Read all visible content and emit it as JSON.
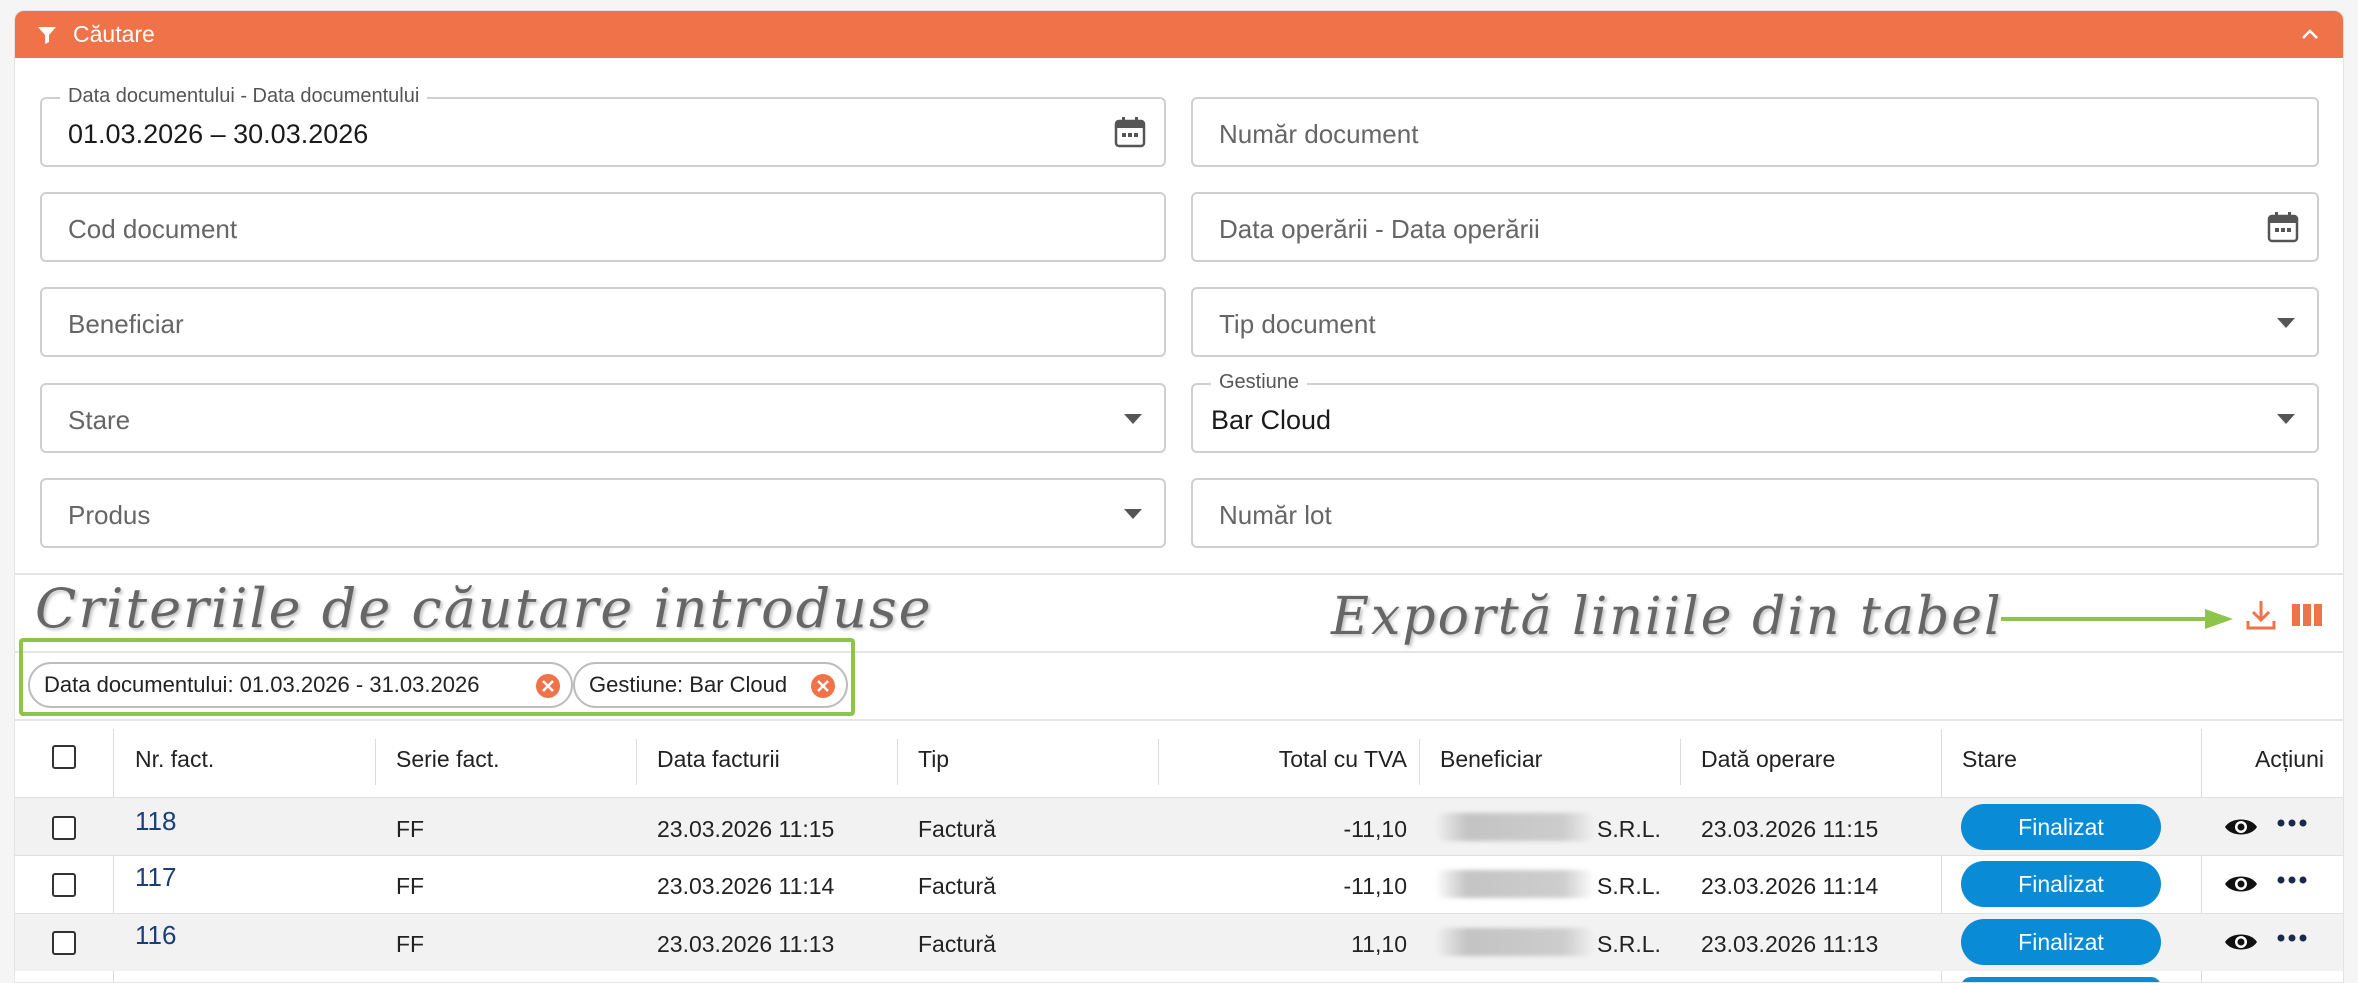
{
  "header": {
    "title": "Căutare",
    "filter_icon": "filter-icon",
    "collapse_icon": "chevron-up-icon",
    "color": "#f07248"
  },
  "filters": {
    "data_documentului": {
      "label": "Data documentului - Data documentului",
      "value": "01.03.2026 – 30.03.2026"
    },
    "numar_document": {
      "placeholder": "Număr document"
    },
    "cod_document": {
      "placeholder": "Cod document"
    },
    "data_operarii": {
      "placeholder": "Data operării - Data operării"
    },
    "beneficiar": {
      "placeholder": "Beneficiar"
    },
    "tip_document": {
      "placeholder": "Tip document"
    },
    "stare": {
      "placeholder": "Stare"
    },
    "gestiune": {
      "label": "Gestiune",
      "value": "Bar Cloud"
    },
    "produs": {
      "placeholder": "Produs"
    },
    "numar_lot": {
      "placeholder": "Număr lot"
    }
  },
  "annotations": {
    "criteria": "Criteriile de căutare introduse",
    "export": "Exportă liniile din tabel"
  },
  "chips": [
    {
      "label": "Data documentului: 01.03.2026 - 31.03.2026"
    },
    {
      "label": "Gestiune: Bar Cloud"
    }
  ],
  "table": {
    "headers": {
      "nr": "Nr. fact.",
      "serie": "Serie fact.",
      "data": "Data facturii",
      "tip": "Tip",
      "total": "Total cu TVA",
      "beneficiar": "Beneficiar",
      "data_operare": "Dată operare",
      "stare": "Stare",
      "actiuni": "Acțiuni"
    },
    "rows": [
      {
        "nr": "118",
        "serie": "FF",
        "data": "23.03.2026 11:15",
        "tip": "Factură",
        "total": "-11,10",
        "beneficiar": "S.R.L.",
        "data_operare": "23.03.2026 11:15",
        "stare": "Finalizat"
      },
      {
        "nr": "117",
        "serie": "FF",
        "data": "23.03.2026 11:14",
        "tip": "Factură",
        "total": "-11,10",
        "beneficiar": "S.R.L.",
        "data_operare": "23.03.2026 11:14",
        "stare": "Finalizat"
      },
      {
        "nr": "116",
        "serie": "FF",
        "data": "23.03.2026 11:13",
        "tip": "Factură",
        "total": "11,10",
        "beneficiar": "S.R.L.",
        "data_operare": "23.03.2026 11:13",
        "stare": "Finalizat"
      }
    ]
  },
  "colors": {
    "accent": "#f07248",
    "status_badge": "#0a8bd6",
    "highlight_box": "#8dc54b"
  }
}
